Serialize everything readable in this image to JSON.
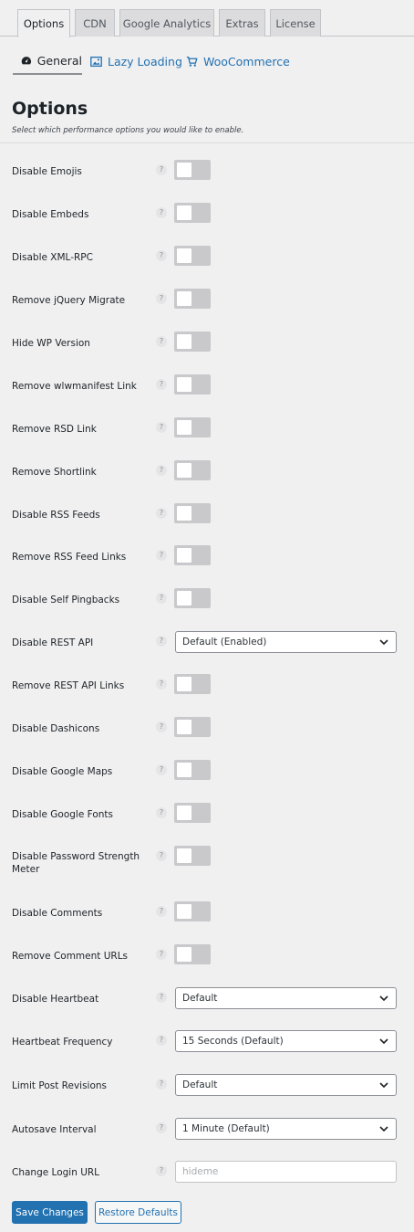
{
  "tabs": [
    {
      "label": "Options"
    },
    {
      "label": "CDN"
    },
    {
      "label": "Google Analytics"
    },
    {
      "label": "Extras"
    },
    {
      "label": "License"
    }
  ],
  "subtabs": [
    {
      "label": "General",
      "icon": "dashboard-icon"
    },
    {
      "label": "Lazy Loading",
      "icon": "image-icon"
    },
    {
      "label": "WooCommerce",
      "icon": "cart-icon"
    }
  ],
  "heading": {
    "title": "Options",
    "subtitle": "Select which performance options you would like to enable."
  },
  "options": {
    "disable_emojis": "Disable Emojis",
    "disable_embeds": "Disable Embeds",
    "disable_xmlrpc": "Disable XML-RPC",
    "remove_jquery_migrate": "Remove jQuery Migrate",
    "hide_wp_version": "Hide WP Version",
    "remove_wlwmanifest": "Remove wlwmanifest Link",
    "remove_rsd": "Remove RSD Link",
    "remove_shortlink": "Remove Shortlink",
    "disable_rss_feeds": "Disable RSS Feeds",
    "remove_rss_feed_links": "Remove RSS Feed Links",
    "disable_self_pingbacks": "Disable Self Pingbacks",
    "disable_rest_api": "Disable REST API",
    "disable_rest_api_value": "Default (Enabled)",
    "remove_rest_api_links": "Remove REST API Links",
    "disable_dashicons": "Disable Dashicons",
    "disable_google_maps": "Disable Google Maps",
    "disable_google_fonts": "Disable Google Fonts",
    "disable_password_strength_meter": "Disable Password Strength Meter",
    "disable_comments": "Disable Comments",
    "remove_comment_urls": "Remove Comment URLs",
    "disable_heartbeat": "Disable Heartbeat",
    "disable_heartbeat_value": "Default",
    "heartbeat_frequency": "Heartbeat Frequency",
    "heartbeat_frequency_value": "15 Seconds (Default)",
    "limit_post_revisions": "Limit Post Revisions",
    "limit_post_revisions_value": "Default",
    "autosave_interval": "Autosave Interval",
    "autosave_interval_value": "1 Minute (Default)",
    "change_login_url": "Change Login URL",
    "change_login_url_placeholder": "hideme"
  },
  "help_glyph": "?",
  "buttons": {
    "save": "Save Changes",
    "restore": "Restore Defaults"
  },
  "colors": {
    "accent": "#2271b1",
    "toggle_off": "#c9c9cc",
    "background": "#f0f0f1"
  }
}
